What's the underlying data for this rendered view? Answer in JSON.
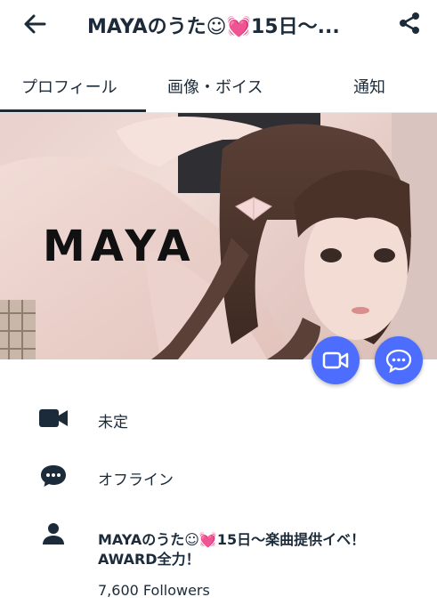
{
  "header": {
    "title": "MAYAのうた☺💓15日〜...",
    "back_icon": "arrow-left-icon",
    "share_icon": "share-icon"
  },
  "tabs": [
    {
      "label": "プロフィール",
      "active": true
    },
    {
      "label": "画像・ボイス",
      "active": false
    },
    {
      "label": "通知",
      "active": false
    }
  ],
  "hero": {
    "overlay_text": "MAYA",
    "video_call_icon": "video-camera-icon",
    "chat_icon": "chat-bubble-icon"
  },
  "profile": {
    "video_status": "未定",
    "online_status": "オフライン",
    "bio": "MAYAのうた☺💓15日〜楽曲提供イベ！AWARD全力！",
    "followers": "7,600 Followers"
  },
  "colors": {
    "accent": "#4d6dff",
    "text": "#1c2b3a"
  }
}
